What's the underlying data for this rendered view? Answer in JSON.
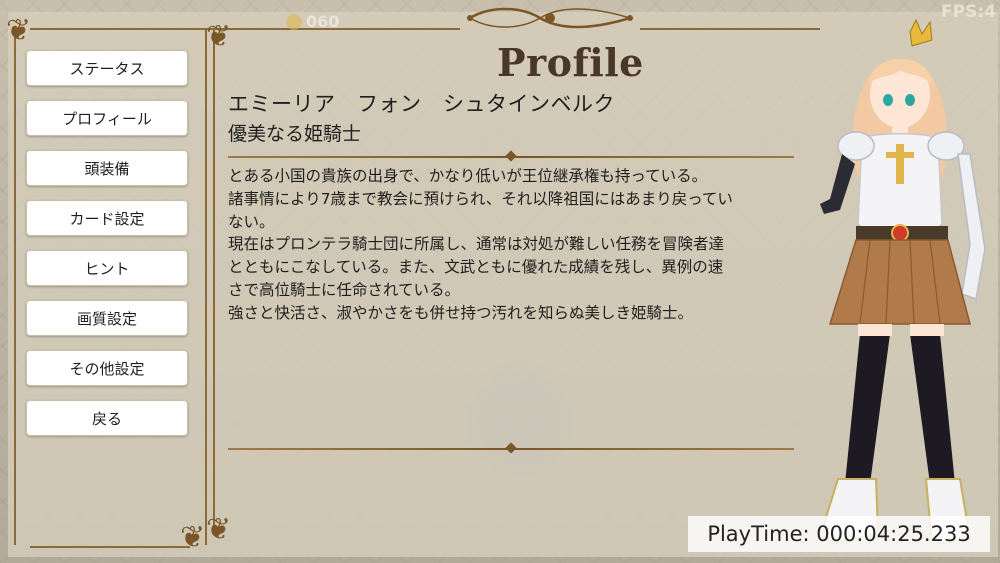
{
  "hud": {
    "score": "060",
    "fps": "FPS:4"
  },
  "profile": {
    "title": "Profile",
    "name": "エミーリア　フォン　シュタインベルク",
    "epithet": "優美なる姫騎士",
    "description": [
      "とある小国の貴族の出身で、かなり低いが王位継承権も持っている。",
      "諸事情により7歳まで教会に預けられ、それ以降祖国にはあまり戻ってい",
      "ない。",
      "現在はプロンテラ騎士団に所属し、通常は対処が難しい任務を冒険者達",
      "とともにこなしている。また、文武ともに優れた成績を残し、異例の速",
      "さで高位騎士に任命されている。",
      "強さと快活さ、淑やかさをも併せ持つ汚れを知らぬ美しき姫騎士。"
    ]
  },
  "menu": {
    "items": [
      {
        "label": "ステータス"
      },
      {
        "label": "プロフィール"
      },
      {
        "label": "頭装備"
      },
      {
        "label": "カード設定"
      },
      {
        "label": "ヒント"
      },
      {
        "label": "画質設定"
      },
      {
        "label": "その他設定"
      },
      {
        "label": "戻る"
      }
    ]
  },
  "footer": {
    "playtime": "PlayTime: 000:04:25.233"
  },
  "colors": {
    "frame": "#8a6a3a",
    "title": "#4a3826",
    "panel": "#d6cebc"
  }
}
